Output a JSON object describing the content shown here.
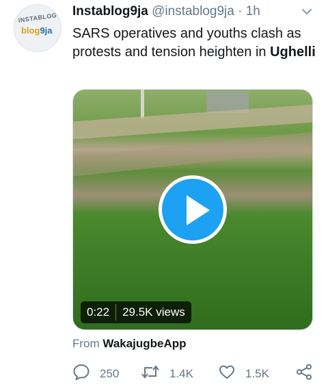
{
  "avatar": {
    "logo_text_top": "INSTABLOG",
    "logo_text_main": "blog",
    "logo_text_suffix": "9ja"
  },
  "tweet": {
    "display_name": "Instablog9ja",
    "handle": "@instablog9ja",
    "separator": "·",
    "time": "1h",
    "text_main": "SARS operatives and youths clash as protests and tension heighten in",
    "text_bold": "Ughelli"
  },
  "video": {
    "duration": "0:22",
    "views": "29.5K views"
  },
  "source": {
    "prefix": "From",
    "app": "WakajugbeApp"
  },
  "actions": {
    "replies": "250",
    "retweets": "1.4K",
    "likes": "1.5K"
  },
  "colors": {
    "accent": "#1da1f2",
    "secondary_text": "#657786"
  },
  "icons": [
    "chevron-down-icon",
    "play-icon",
    "reply-icon",
    "retweet-icon",
    "like-icon",
    "share-icon"
  ]
}
